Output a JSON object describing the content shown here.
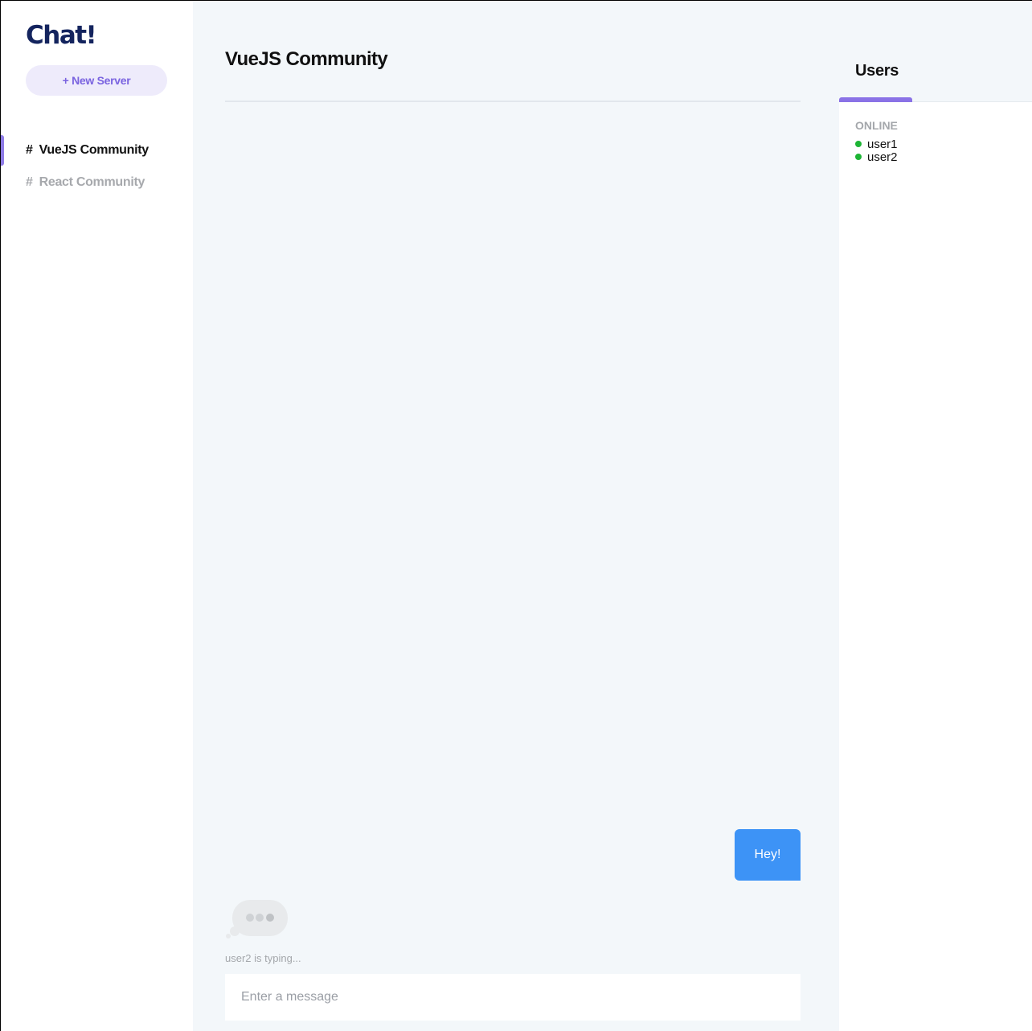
{
  "app": {
    "logo": "Chat!",
    "new_server_label": "+ New Server"
  },
  "servers": [
    {
      "hash": "#",
      "name": "VueJS Community",
      "active": true
    },
    {
      "hash": "#",
      "name": "React Community",
      "active": false
    }
  ],
  "channel": {
    "title": "VueJS Community"
  },
  "messages": [
    {
      "text": "Hey!",
      "own": true
    }
  ],
  "typing": {
    "text": "user2 is typing..."
  },
  "composer": {
    "placeholder": "Enter a message"
  },
  "users_panel": {
    "tab_label": "Users",
    "online_label": "ONLINE",
    "users": [
      {
        "name": "user1"
      },
      {
        "name": "user2"
      }
    ]
  },
  "colors": {
    "accent": "#8a72e6",
    "message_bubble": "#3d93f6",
    "online": "#1db535",
    "logo": "#14245e"
  },
  "icons": {
    "typing": "typing-bubble-icon",
    "online": "online-status-icon"
  }
}
